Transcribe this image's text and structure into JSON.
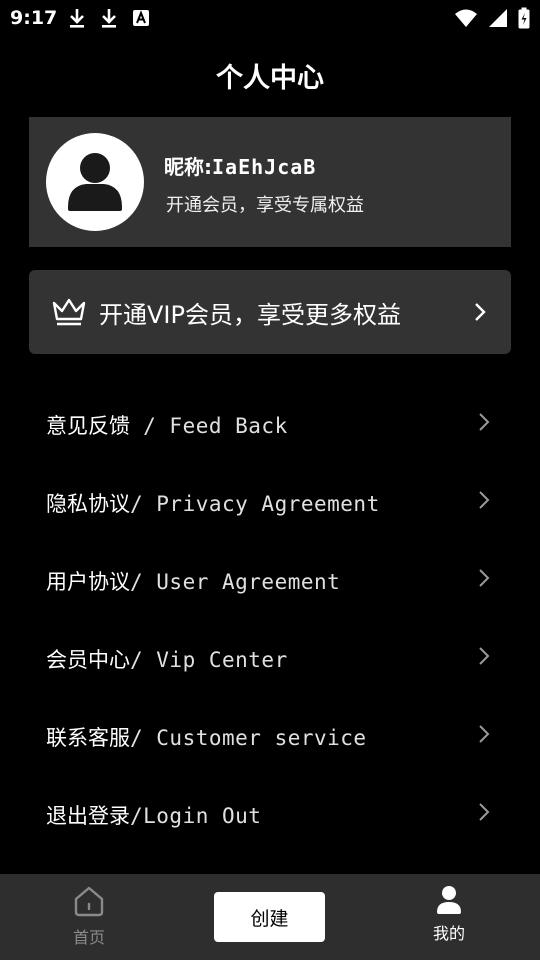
{
  "status_bar": {
    "time": "9:17",
    "left_icons": [
      "download-icon",
      "download-icon",
      "font-app-icon"
    ],
    "right_icons": [
      "wifi-icon",
      "signal-icon",
      "battery-icon"
    ]
  },
  "header": {
    "title": "个人中心"
  },
  "profile": {
    "nickname_label": "昵称:",
    "nickname_value": "IaEhJcaB",
    "subtitle": "开通会员，享受专属权益",
    "avatar_icon": "user-avatar-icon"
  },
  "vip_banner": {
    "icon": "crown-icon",
    "text": "开通VIP会员，享受更多权益"
  },
  "menu": {
    "items": [
      {
        "cn": "意见反馈",
        "en": " / Feed Back"
      },
      {
        "cn": "隐私协议",
        "en": "/ Privacy Agreement"
      },
      {
        "cn": "用户协议",
        "en": "/ User Agreement"
      },
      {
        "cn": "会员中心",
        "en": "/ Vip Center"
      },
      {
        "cn": "联系客服",
        "en": "/ Customer service"
      },
      {
        "cn": "退出登录",
        "en": "/Login Out"
      }
    ]
  },
  "bottom_nav": {
    "home_label": "首页",
    "create_label": "创建",
    "mine_label": "我的"
  },
  "colors": {
    "background": "#000000",
    "card": "#333333",
    "bottom_bar": "#2e2e2e",
    "inactive_tab": "#8a8a8a"
  }
}
